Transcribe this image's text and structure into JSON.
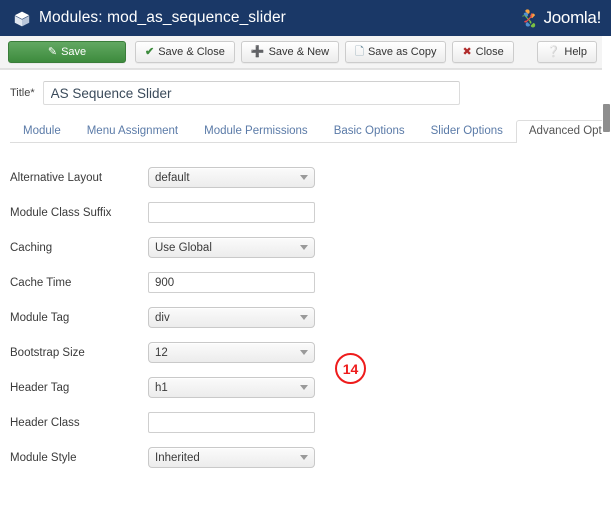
{
  "header": {
    "icon": "cube-icon",
    "title": "Modules: mod_as_sequence_slider",
    "brand": "Joomla!",
    "brand_mark": "joomla-logo-icon",
    "bg_color": "#1a3867"
  },
  "toolbar": {
    "save_label": "Save",
    "save_icon": "pencil-square-icon",
    "save_close_label": "Save & Close",
    "save_close_icon": "check-icon",
    "save_new_label": "Save & New",
    "save_new_icon": "plus-icon",
    "save_copy_label": "Save as Copy",
    "save_copy_icon": "copy-icon",
    "close_label": "Close",
    "close_icon": "circle-x-icon",
    "help_label": "Help",
    "help_icon": "question-circle-icon",
    "primary_color": "#3d8b3d"
  },
  "title_field": {
    "label": "Title",
    "required_marker": "*",
    "value": "AS Sequence Slider",
    "placeholder": ""
  },
  "tabs": [
    {
      "label": "Module",
      "active": false
    },
    {
      "label": "Menu Assignment",
      "active": false
    },
    {
      "label": "Module Permissions",
      "active": false
    },
    {
      "label": "Basic Options",
      "active": false
    },
    {
      "label": "Slider Options",
      "active": false
    },
    {
      "label": "Advanced Options",
      "active": true
    }
  ],
  "form": {
    "fields": [
      {
        "label": "Alternative Layout",
        "type": "select",
        "value": "default",
        "placeholder": ""
      },
      {
        "label": "Module Class Suffix",
        "type": "text",
        "value": "",
        "placeholder": ""
      },
      {
        "label": "Caching",
        "type": "select",
        "value": "Use Global",
        "placeholder": ""
      },
      {
        "label": "Cache Time",
        "type": "text",
        "value": "900",
        "placeholder": ""
      },
      {
        "label": "Module Tag",
        "type": "select",
        "value": "div",
        "placeholder": ""
      },
      {
        "label": "Bootstrap Size",
        "type": "select",
        "value": "12",
        "placeholder": ""
      },
      {
        "label": "Header Tag",
        "type": "select",
        "value": "h1",
        "placeholder": ""
      },
      {
        "label": "Header Class",
        "type": "text",
        "value": "",
        "placeholder": ""
      },
      {
        "label": "Module Style",
        "type": "select",
        "value": "Inherited",
        "placeholder": ""
      }
    ]
  },
  "annotation": {
    "number": "14",
    "color": "#ee1c1c"
  }
}
